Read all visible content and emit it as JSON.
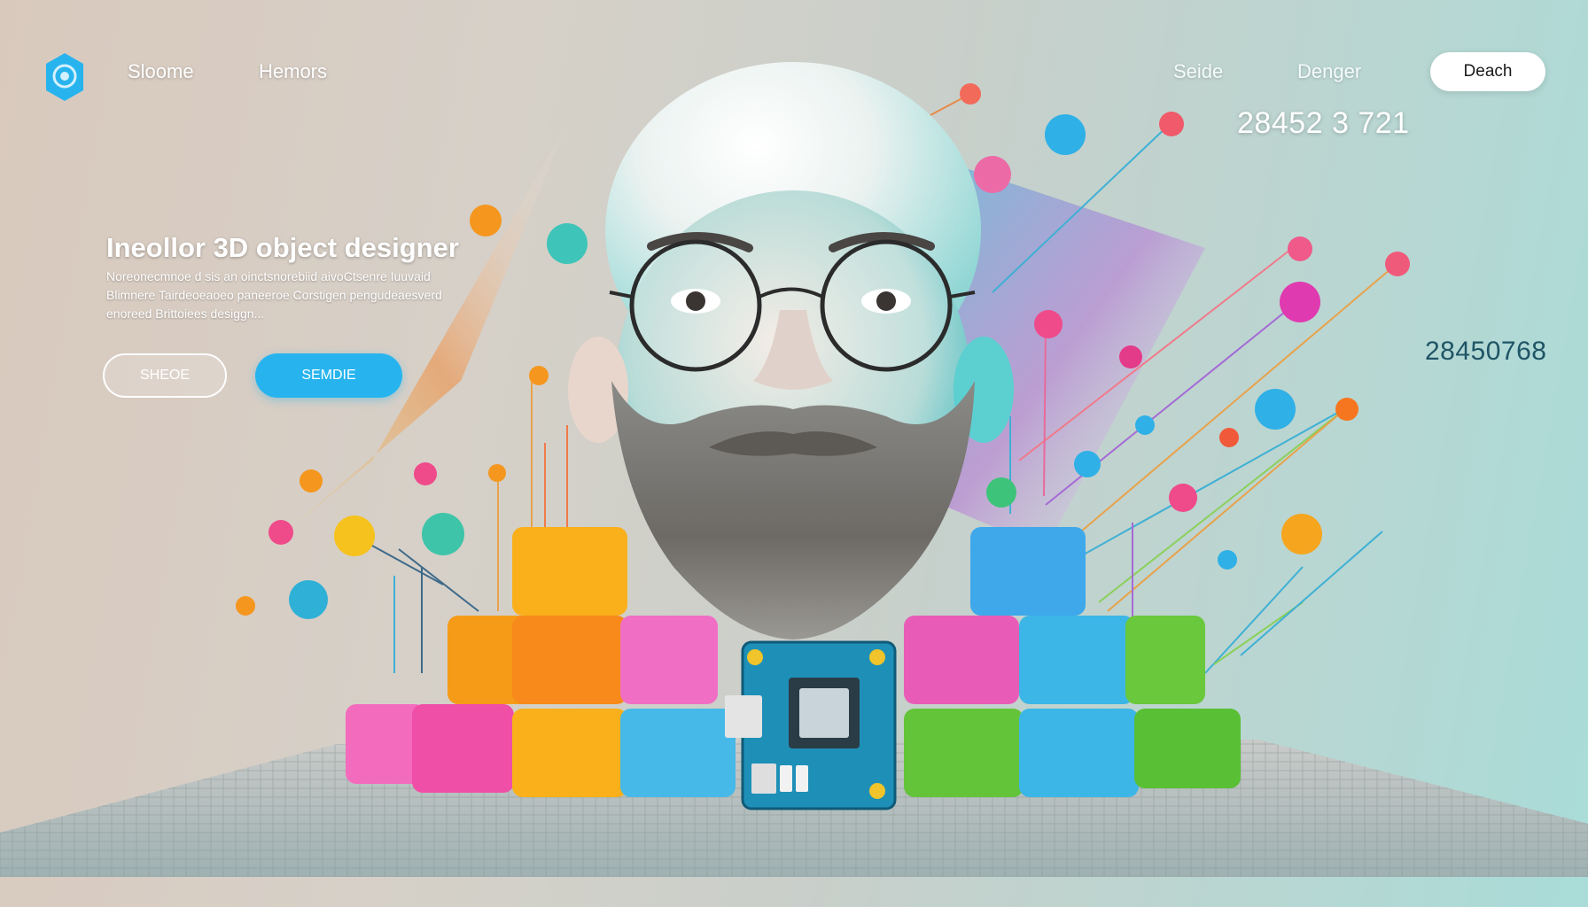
{
  "nav": {
    "logo_icon": "rose-logo-icon",
    "left_links": [
      "Sloome",
      "Hemors"
    ],
    "right_links": [
      "Seide",
      "Denger"
    ],
    "search_label": "Deach"
  },
  "stats": {
    "top_value": "28452 3 721",
    "side_value": "28450768"
  },
  "hero": {
    "headline": "Ineollor  3D object designer",
    "description": "Noreonecmnoe d sis an oinctsnorebiid aivoCtsenre Iuuvaid Blimnere Tairdeoeaoeo paneeroe Corstigen pengudeaesverd enoreed Brittoiees desiggn...",
    "btn_outline_label": "SHEOE",
    "btn_filled_label": "SEMDIE"
  },
  "colors": {
    "accent": "#27b4ee",
    "cube_yellow": "#f7b51b",
    "cube_orange": "#f59a1c",
    "cube_pink": "#f06fb8",
    "cube_blue": "#44b4e8",
    "cube_green": "#6cc93c",
    "pcb": "#1e90b8"
  }
}
